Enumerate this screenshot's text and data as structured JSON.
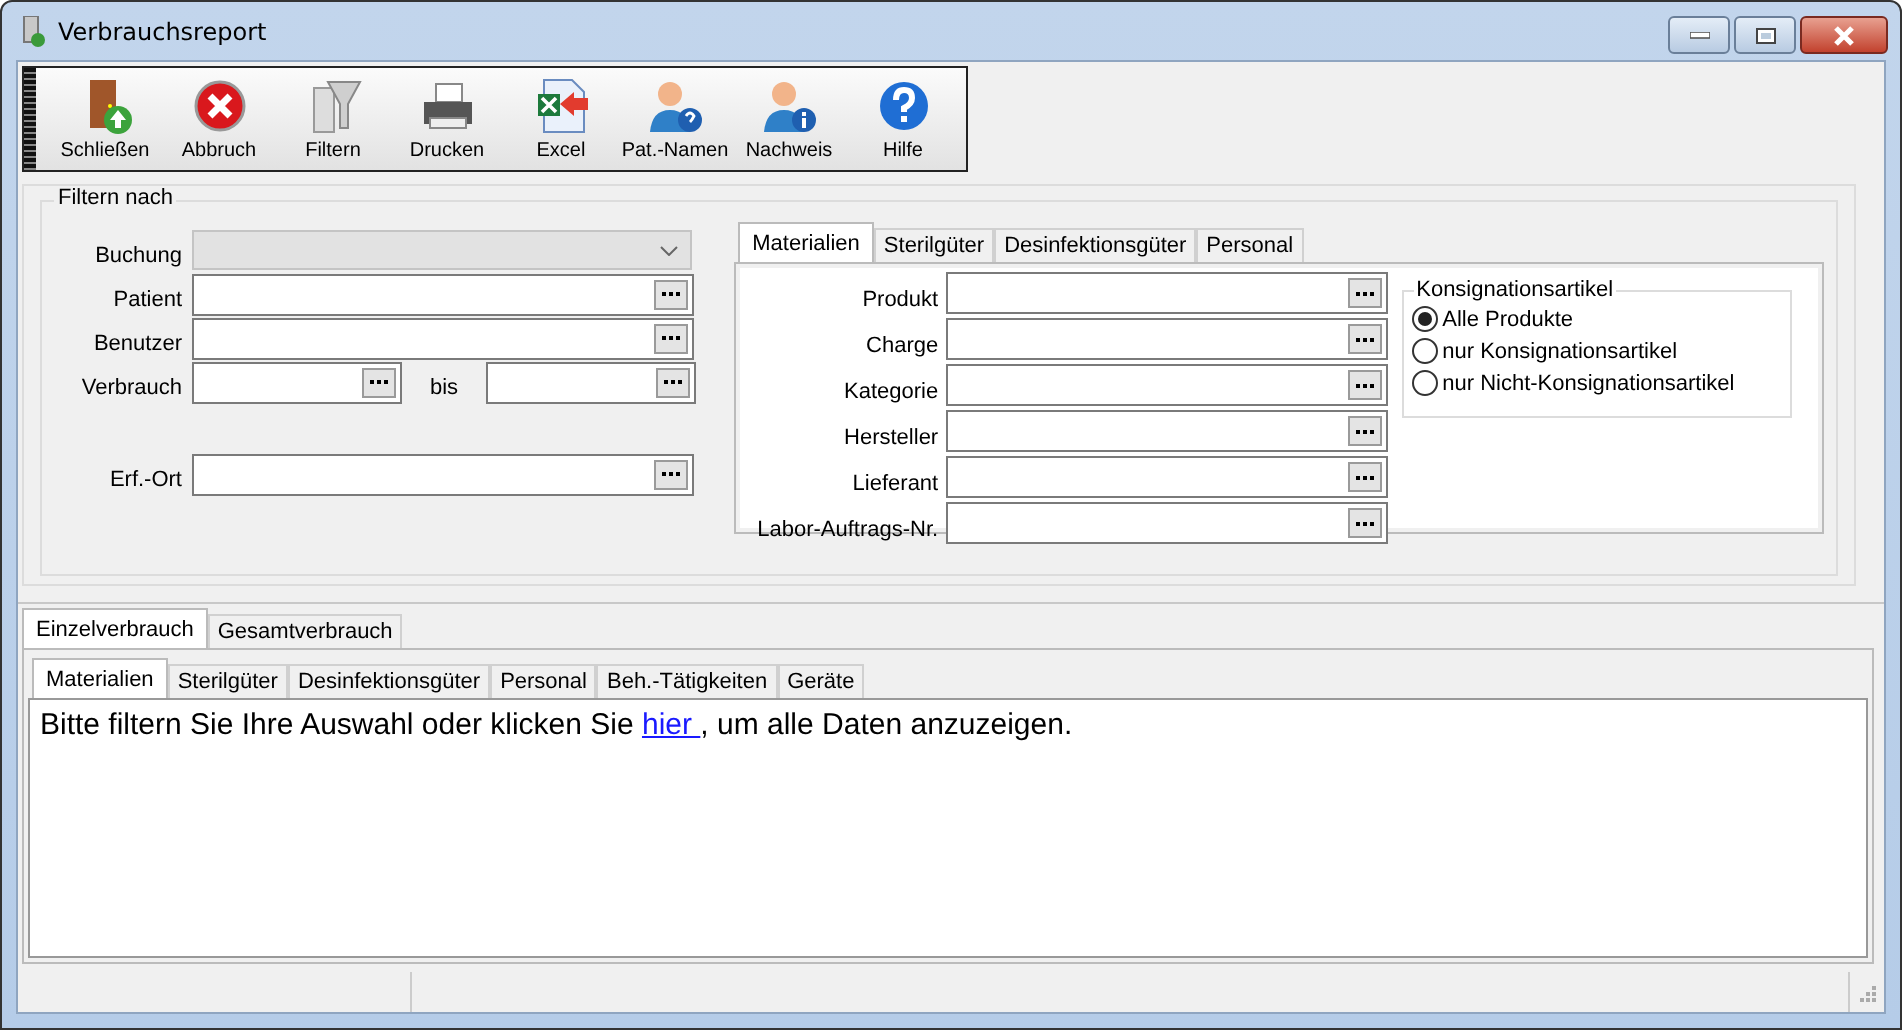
{
  "window": {
    "title": "Verbrauchsreport"
  },
  "toolbar": [
    {
      "label": "Schließen",
      "kind": "door"
    },
    {
      "label": "Abbruch",
      "kind": "cancel"
    },
    {
      "label": "Filtern",
      "kind": "funnel"
    },
    {
      "label": "Drucken",
      "kind": "printer"
    },
    {
      "label": "Excel",
      "kind": "excel"
    },
    {
      "label": "Pat.-Namen",
      "kind": "person-question"
    },
    {
      "label": "Nachweis",
      "kind": "person-info"
    },
    {
      "label": "Hilfe",
      "kind": "help"
    }
  ],
  "filter": {
    "title": "Filtern nach",
    "fields": [
      {
        "label": "Buchung",
        "kind": "combo",
        "disabled": true
      },
      {
        "label": "Patient",
        "kind": "browse",
        "disabled": false
      },
      {
        "label": "Benutzer",
        "kind": "browse",
        "disabled": false
      },
      {
        "label": "Verbrauch",
        "kind": "range",
        "to_label": "bis",
        "disabled": false
      },
      {
        "label": "Erf.-Ort",
        "kind": "browse",
        "disabled": false
      }
    ]
  },
  "filter_tabs": [
    {
      "label": "Materialien",
      "selected": true
    },
    {
      "label": "Sterilgüter",
      "selected": false
    },
    {
      "label": "Desinfektionsgüter",
      "selected": false
    },
    {
      "label": "Personal",
      "selected": false
    }
  ],
  "material_fields": [
    {
      "label": "Produkt"
    },
    {
      "label": "Charge"
    },
    {
      "label": "Kategorie"
    },
    {
      "label": "Hersteller"
    },
    {
      "label": "Lieferant"
    },
    {
      "label": "Labor-Auftrags-Nr."
    }
  ],
  "consignment": {
    "title": "Konsignationsartikel",
    "options": [
      {
        "label": "Alle Produkte",
        "selected": true
      },
      {
        "label": "nur Konsignationsartikel",
        "selected": false
      },
      {
        "label": "nur Nicht-Konsignationsartikel",
        "selected": false
      }
    ]
  },
  "result_tabs": [
    {
      "label": "Einzelverbrauch",
      "selected": true
    },
    {
      "label": "Gesamtverbrauch",
      "selected": false
    }
  ],
  "result_subtabs": [
    {
      "label": "Materialien",
      "selected": true
    },
    {
      "label": "Sterilgüter",
      "selected": false
    },
    {
      "label": "Desinfektionsgüter",
      "selected": false
    },
    {
      "label": "Personal",
      "selected": false
    },
    {
      "label": "Beh.-Tätigkeiten",
      "selected": false
    },
    {
      "label": "Geräte",
      "selected": false
    }
  ],
  "message": {
    "before": "Bitte filtern Sie Ihre Auswahl oder klicken Sie ",
    "link": " hier ",
    "after": ", um alle Daten anzuzeigen."
  }
}
